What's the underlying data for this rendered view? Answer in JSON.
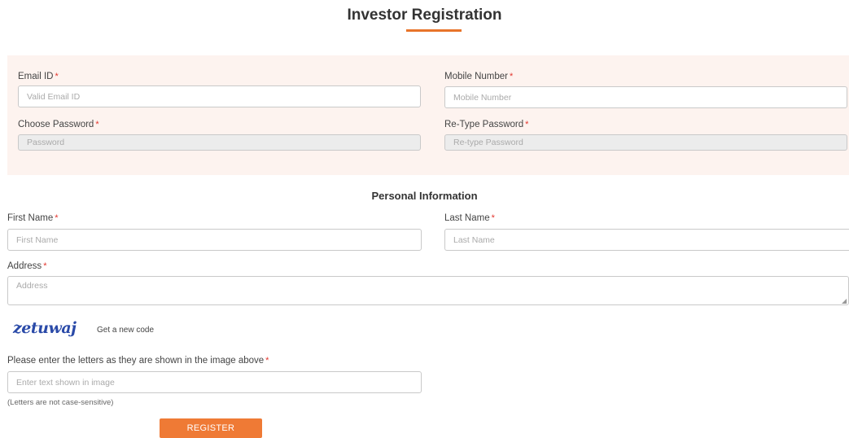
{
  "page": {
    "title": "Investor Registration"
  },
  "account": {
    "email_label": "Email ID",
    "email_placeholder": "Valid Email ID",
    "mobile_label": "Mobile Number",
    "mobile_placeholder": "Mobile Number",
    "password_label": "Choose Password",
    "password_placeholder": "Password",
    "retype_label": "Re-Type Password",
    "retype_placeholder": "Re-type Password"
  },
  "personal": {
    "section_title": "Personal Information",
    "first_name_label": "First Name",
    "first_name_placeholder": "First Name",
    "last_name_label": "Last Name",
    "last_name_placeholder": "Last Name",
    "address_label": "Address",
    "address_placeholder": "Address"
  },
  "captcha": {
    "image_text": "zetuwaj",
    "new_code_link": "Get a new code",
    "prompt_label": "Please enter the letters as they are shown in the image above",
    "input_placeholder": "Enter text shown in image",
    "hint": "(Letters are not case-sensitive)"
  },
  "required_marker": "*",
  "actions": {
    "register_label": "REGISTER"
  },
  "colors": {
    "accent": "#ef7a35",
    "panel_background": "#fdf3ef",
    "required": "#e3362e"
  }
}
